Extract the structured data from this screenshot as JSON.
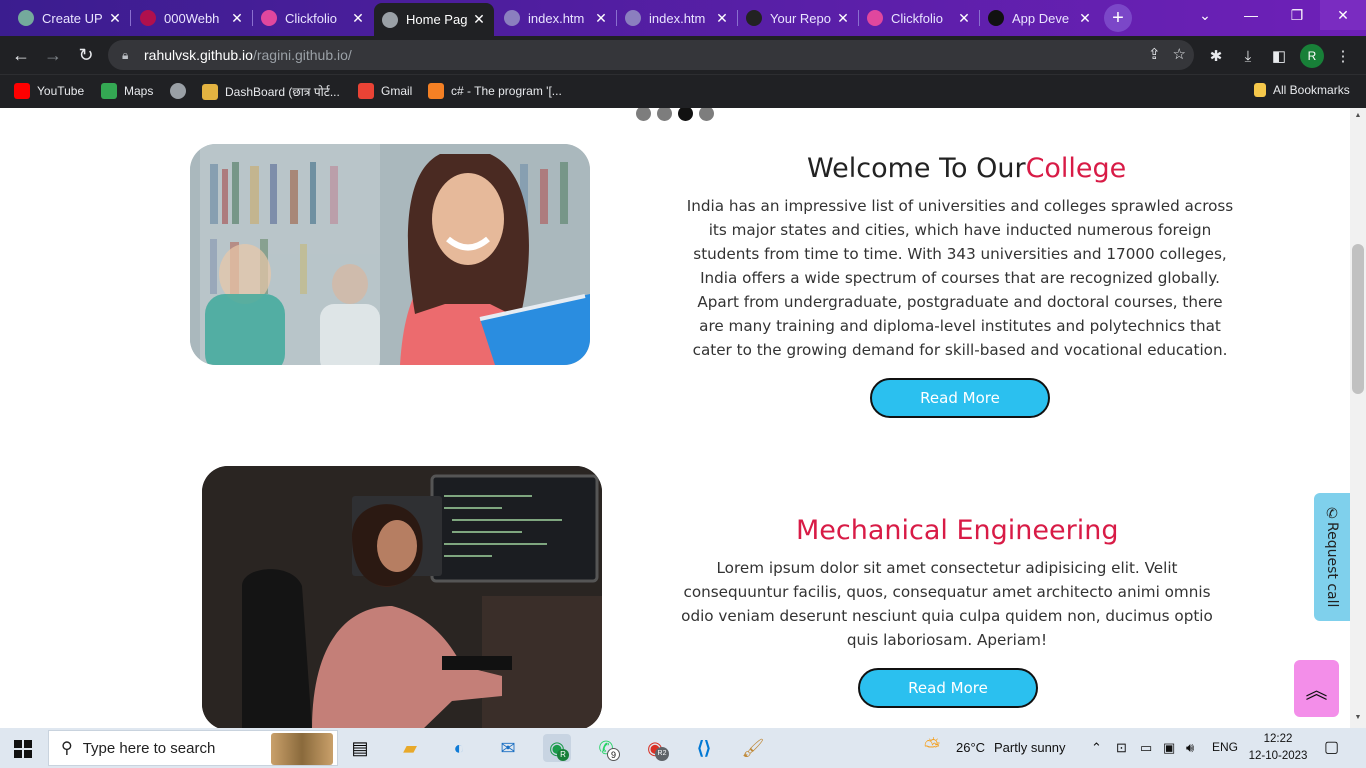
{
  "tabs": [
    {
      "title": "Create UP",
      "icon": "chatgpt-icon",
      "color": "#74aa9c"
    },
    {
      "title": "000Webh",
      "icon": "webhost-icon",
      "color": "#b0104d"
    },
    {
      "title": "Clickfolio",
      "icon": "clickfolio-icon",
      "color": "#e0479e"
    },
    {
      "title": "Home Pag",
      "icon": "globe-icon",
      "color": "#9aa0a6",
      "active": true
    },
    {
      "title": "index.htm",
      "icon": "globe-icon",
      "color": "#8b7fbf"
    },
    {
      "title": "index.htm",
      "icon": "globe-icon",
      "color": "#8b7fbf"
    },
    {
      "title": "Your Repo",
      "icon": "github-icon",
      "color": "#222"
    },
    {
      "title": "Clickfolio",
      "icon": "clickfolio-icon",
      "color": "#e0479e"
    },
    {
      "title": "App Deve",
      "icon": "app-icon",
      "color": "#111"
    }
  ],
  "address": {
    "host": "rahulvsk.github.io",
    "path": "/ragini.github.io/"
  },
  "profile_initial": "R",
  "bookmarks": [
    {
      "label": "YouTube",
      "icon": "youtube-icon",
      "color": "#ff0000"
    },
    {
      "label": "Maps",
      "icon": "maps-icon",
      "color": "#34a853"
    },
    {
      "label": "",
      "icon": "globe-icon",
      "color": "#9aa0a6"
    },
    {
      "label": "DashBoard (छात्र पोर्ट...",
      "icon": "dashboard-icon",
      "color": "#e3b341"
    },
    {
      "label": "Gmail",
      "icon": "gmail-icon",
      "color": "#ea4335"
    },
    {
      "label": "c# - The program '[...",
      "icon": "stackoverflow-icon",
      "color": "#f48024"
    }
  ],
  "all_bookmarks": "All Bookmarks",
  "slider": {
    "count": 4,
    "active": 2
  },
  "section1": {
    "title_a": "Welcome To Our",
    "title_b": "College",
    "text": "India has an impressive list of universities and colleges sprawled across its major states and cities, which have inducted numerous foreign students from time to time. With 343 universities and 17000 colleges, India offers a wide spectrum of courses that are recognized globally. Apart from undergraduate, postgraduate and doctoral courses, there are many training and diploma-level institutes and polytechnics that cater to the growing demand for skill-based and vocational education.",
    "button": "Read More"
  },
  "section2": {
    "title": "Mechanical Engineering",
    "text": "Lorem ipsum dolor sit amet consectetur adipisicing elit. Velit consequuntur facilis, quos, consequatur amet architecto animi omnis odio veniam deserunt nesciunt quia culpa quidem non, ducimus optio quis laboriosam. Aperiam!",
    "button": "Read More"
  },
  "request_call": "Request call",
  "colors": {
    "accent": "#d81b46",
    "button": "#2bc0ef",
    "to_top": "#f38ee9",
    "request": "#7fd0ec"
  },
  "taskbar": {
    "search_placeholder": "Type here to search",
    "chrome_badge_1": "R",
    "whatsapp_badge": "9",
    "chrome_badge_2": "R2",
    "weather_temp": "26°C",
    "weather_text": "Partly sunny",
    "language": "ENG",
    "time": "12:22",
    "date": "12-10-2023"
  }
}
